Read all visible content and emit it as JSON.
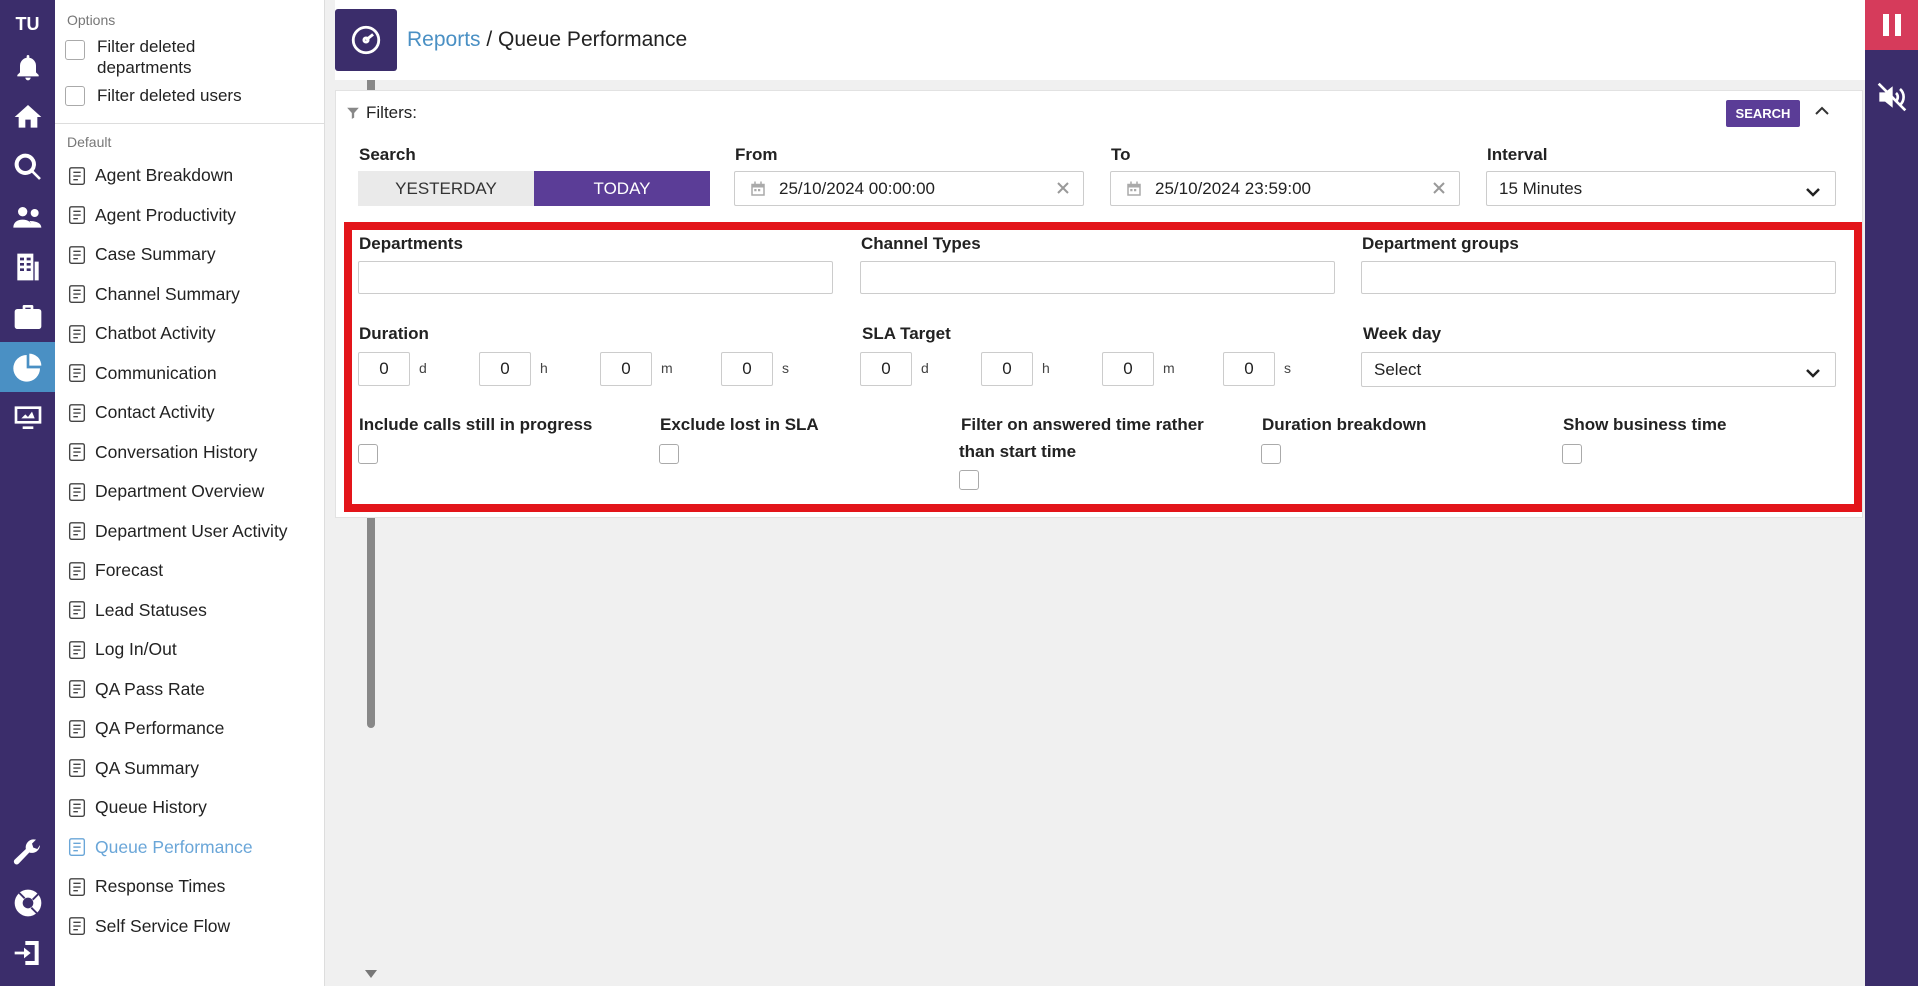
{
  "rail": {
    "initials": "TU",
    "icons": [
      "bell-icon",
      "home-icon",
      "search-icon",
      "users-icon",
      "building-icon",
      "briefcase-icon",
      "reports-pie-icon",
      "monitor-icon",
      "wrench-icon",
      "lifebuoy-icon",
      "logout-icon"
    ]
  },
  "options": {
    "section_options": "Options",
    "filter_deleted_departments": "Filter deleted departments",
    "filter_deleted_users": "Filter deleted users",
    "section_default": "Default",
    "reports": [
      {
        "label": "Agent Breakdown",
        "icon": "user-outline-icon"
      },
      {
        "label": "Agent Productivity",
        "icon": "badge-icon"
      },
      {
        "label": "Case Summary",
        "icon": "briefcase-outline-icon"
      },
      {
        "label": "Channel Summary",
        "icon": "area-chart-icon"
      },
      {
        "label": "Chatbot Activity",
        "icon": "sigma-icon"
      },
      {
        "label": "Communication",
        "icon": "people-icon"
      },
      {
        "label": "Contact Activity",
        "icon": "contact-card-icon"
      },
      {
        "label": "Conversation History",
        "icon": "history-icon"
      },
      {
        "label": "Department Overview",
        "icon": "department-icon"
      },
      {
        "label": "Department User Activity",
        "icon": "user-activity-icon"
      },
      {
        "label": "Forecast",
        "icon": "forecast-icon"
      },
      {
        "label": "Lead Statuses",
        "icon": "lead-list-icon"
      },
      {
        "label": "Log In/Out",
        "icon": "login-icon"
      },
      {
        "label": "QA Pass Rate",
        "icon": "file-check-icon"
      },
      {
        "label": "QA Performance",
        "icon": "file-chart-icon"
      },
      {
        "label": "QA Summary",
        "icon": "file-text-icon"
      },
      {
        "label": "Queue History",
        "icon": "watch-icon"
      },
      {
        "label": "Queue Performance",
        "icon": "gauge-icon",
        "active": true
      },
      {
        "label": "Response Times",
        "icon": "stopwatch-icon"
      },
      {
        "label": "Self Service Flow",
        "icon": "robot-icon"
      }
    ]
  },
  "header": {
    "crumb_link": "Reports",
    "crumb_sep": " / ",
    "crumb_current": "Queue Performance"
  },
  "filters": {
    "title": "Filters:",
    "search_button": "SEARCH",
    "search_label": "Search",
    "yesterday": "YESTERDAY",
    "today": "TODAY",
    "from_label": "From",
    "from_value": "25/10/2024 00:00:00",
    "to_label": "To",
    "to_value": "25/10/2024 23:59:00",
    "interval_label": "Interval",
    "interval_value": "15 Minutes",
    "departments_label": "Departments",
    "channel_types_label": "Channel Types",
    "department_groups_label": "Department groups",
    "duration_label": "Duration",
    "sla_label": "SLA Target",
    "weekday_label": "Week day",
    "weekday_value": "Select",
    "duration": {
      "d": "0",
      "h": "0",
      "m": "0",
      "s": "0"
    },
    "sla": {
      "d": "0",
      "h": "0",
      "m": "0",
      "s": "0"
    },
    "units": {
      "d": "d",
      "h": "h",
      "m": "m",
      "s": "s"
    },
    "include_calls": "Include calls still in progress",
    "exclude_lost": "Exclude lost in SLA",
    "filter_answered_1": "Filter on answered time rather",
    "filter_answered_2": "than start time",
    "duration_breakdown": "Duration breakdown",
    "show_business_time": "Show business time"
  },
  "colors": {
    "rail": "#3b2d6b",
    "accent": "#5b3d97",
    "link": "#4a90c4",
    "highlight": "#e3151a",
    "pause": "#d63b5b"
  }
}
